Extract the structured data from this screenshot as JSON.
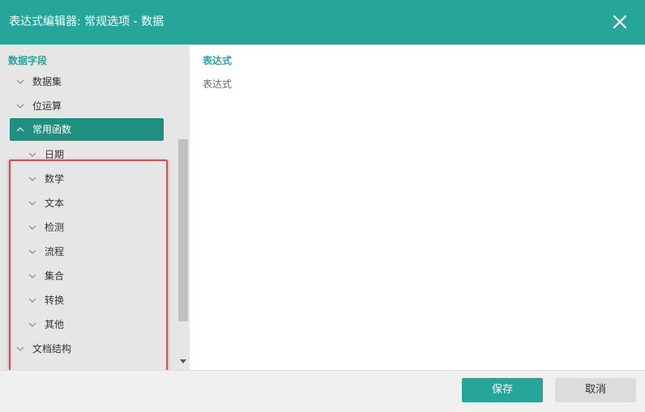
{
  "window": {
    "title": "表达式编辑器: 常规选项 - 数据"
  },
  "tree": {
    "header": "数据字段",
    "items": [
      {
        "label": "数据集",
        "level": 0,
        "state": "collapsed"
      },
      {
        "label": "位运算",
        "level": 0,
        "state": "collapsed"
      },
      {
        "label": "常用函数",
        "level": 0,
        "state": "expanded",
        "selected": true
      },
      {
        "label": "日期",
        "level": 1,
        "state": "collapsed"
      },
      {
        "label": "数学",
        "level": 1,
        "state": "collapsed"
      },
      {
        "label": "文本",
        "level": 1,
        "state": "collapsed"
      },
      {
        "label": "检测",
        "level": 1,
        "state": "collapsed"
      },
      {
        "label": "流程",
        "level": 1,
        "state": "collapsed"
      },
      {
        "label": "集合",
        "level": 1,
        "state": "collapsed"
      },
      {
        "label": "转换",
        "level": 1,
        "state": "collapsed"
      },
      {
        "label": "其他",
        "level": 1,
        "state": "collapsed"
      },
      {
        "label": "文档结构",
        "level": 0,
        "state": "collapsed"
      }
    ]
  },
  "expression": {
    "title": "表达式",
    "placeholder": "表达式",
    "value": ""
  },
  "footer": {
    "save_label": "保存",
    "cancel_label": "取消"
  },
  "colors": {
    "accent": "#26a69a",
    "selected_bg": "#1f8f80",
    "highlight": "#e8474b"
  },
  "icons": {
    "close": "close-icon",
    "chevron_collapsed": "chevron-down-icon",
    "chevron_expanded": "chevron-up-icon"
  }
}
